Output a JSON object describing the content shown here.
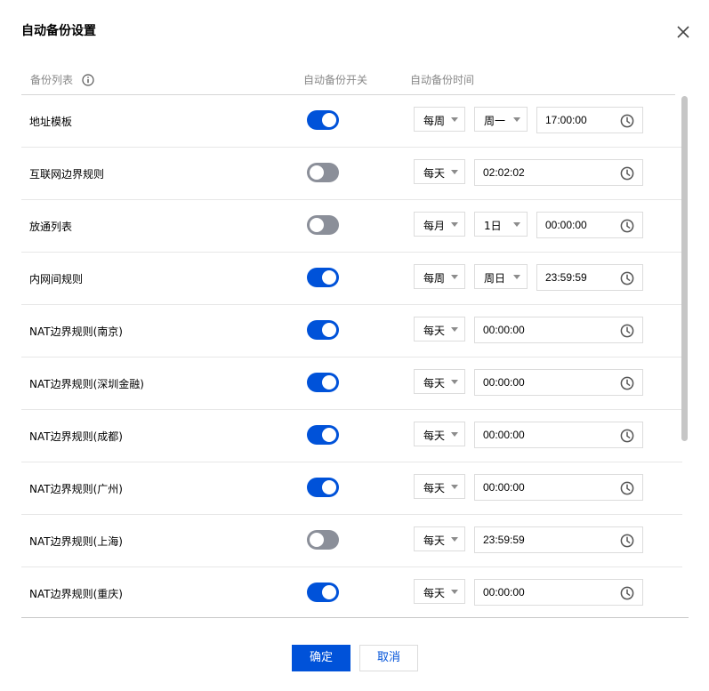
{
  "dialog": {
    "title": "自动备份设置",
    "confirm_label": "确定",
    "cancel_label": "取消"
  },
  "table": {
    "columns": [
      "备份列表",
      "自动备份开关",
      "自动备份时间"
    ],
    "rows": [
      {
        "name": "地址模板",
        "enabled": true,
        "frequency": "每周",
        "day": "周一",
        "time": "17:00:00"
      },
      {
        "name": "互联网边界规则",
        "enabled": false,
        "frequency": "每天",
        "day": null,
        "time": "02:02:02"
      },
      {
        "name": "放通列表",
        "enabled": false,
        "frequency": "每月",
        "day": "1日",
        "time": "00:00:00"
      },
      {
        "name": "内网间规则",
        "enabled": true,
        "frequency": "每周",
        "day": "周日",
        "time": "23:59:59"
      },
      {
        "name": "NAT边界规则(南京)",
        "enabled": true,
        "frequency": "每天",
        "day": null,
        "time": "00:00:00"
      },
      {
        "name": "NAT边界规则(深圳金融)",
        "enabled": true,
        "frequency": "每天",
        "day": null,
        "time": "00:00:00"
      },
      {
        "name": "NAT边界规则(成都)",
        "enabled": true,
        "frequency": "每天",
        "day": null,
        "time": "00:00:00"
      },
      {
        "name": "NAT边界规则(广州)",
        "enabled": true,
        "frequency": "每天",
        "day": null,
        "time": "00:00:00"
      },
      {
        "name": "NAT边界规则(上海)",
        "enabled": false,
        "frequency": "每天",
        "day": null,
        "time": "23:59:59"
      },
      {
        "name": "NAT边界规则(重庆)",
        "enabled": true,
        "frequency": "每天",
        "day": null,
        "time": "00:00:00"
      }
    ]
  },
  "icons": {
    "close": "close-icon",
    "info": "info-icon",
    "dropdown": "chevron-down-icon",
    "clock": "clock-icon"
  },
  "colors": {
    "accent": "#0052d9",
    "toggle_off": "#8b8f99",
    "border": "#dcdcdc"
  }
}
